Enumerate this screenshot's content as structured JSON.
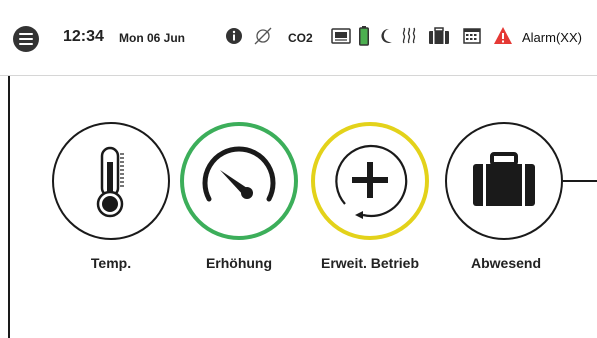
{
  "status_bar": {
    "time": "12:34",
    "date": "Mon 06 Jun",
    "co2_label": "CO2",
    "alarm_label": "Alarm(XX)",
    "icons": [
      "menu-icon",
      "info-icon",
      "no-signal-icon",
      "co2-label",
      "keyboard-icon",
      "battery-icon",
      "night-mode-icon",
      "heating-icon",
      "suitcase-icon",
      "calendar-icon",
      "warning-icon"
    ],
    "colors": {
      "battery": "#4caf50",
      "warning": "#e53935"
    }
  },
  "modes": [
    {
      "label": "Temp.",
      "icon": "thermometer-icon",
      "ring_color": "#1a1a1a"
    },
    {
      "label": "Erhöhung",
      "icon": "speedometer-icon",
      "ring_color": "#3cae5a"
    },
    {
      "label": "Erweit. Betrieb",
      "icon": "plus-refresh-icon",
      "ring_color": "#e3d21a"
    },
    {
      "label": "Abwesend",
      "icon": "suitcase-icon",
      "ring_color": "#1a1a1a"
    }
  ]
}
